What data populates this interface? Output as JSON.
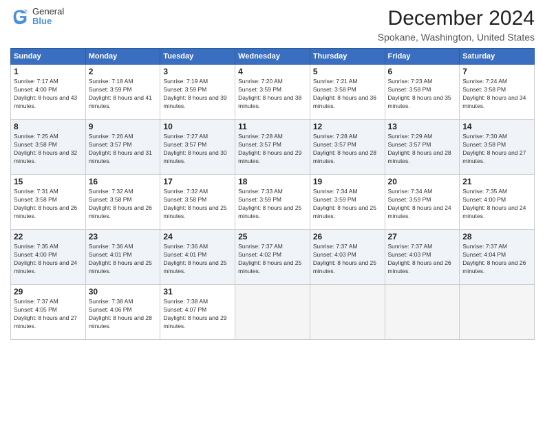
{
  "logo": {
    "general": "General",
    "blue": "Blue"
  },
  "header": {
    "title": "December 2024",
    "subtitle": "Spokane, Washington, United States"
  },
  "weekdays": [
    "Sunday",
    "Monday",
    "Tuesday",
    "Wednesday",
    "Thursday",
    "Friday",
    "Saturday"
  ],
  "weeks": [
    [
      {
        "day": "1",
        "sunrise": "7:17 AM",
        "sunset": "4:00 PM",
        "daylight": "8 hours and 43 minutes."
      },
      {
        "day": "2",
        "sunrise": "7:18 AM",
        "sunset": "3:59 PM",
        "daylight": "8 hours and 41 minutes."
      },
      {
        "day": "3",
        "sunrise": "7:19 AM",
        "sunset": "3:59 PM",
        "daylight": "8 hours and 39 minutes."
      },
      {
        "day": "4",
        "sunrise": "7:20 AM",
        "sunset": "3:59 PM",
        "daylight": "8 hours and 38 minutes."
      },
      {
        "day": "5",
        "sunrise": "7:21 AM",
        "sunset": "3:58 PM",
        "daylight": "8 hours and 36 minutes."
      },
      {
        "day": "6",
        "sunrise": "7:23 AM",
        "sunset": "3:58 PM",
        "daylight": "8 hours and 35 minutes."
      },
      {
        "day": "7",
        "sunrise": "7:24 AM",
        "sunset": "3:58 PM",
        "daylight": "8 hours and 34 minutes."
      }
    ],
    [
      {
        "day": "8",
        "sunrise": "7:25 AM",
        "sunset": "3:58 PM",
        "daylight": "8 hours and 32 minutes."
      },
      {
        "day": "9",
        "sunrise": "7:26 AM",
        "sunset": "3:57 PM",
        "daylight": "8 hours and 31 minutes."
      },
      {
        "day": "10",
        "sunrise": "7:27 AM",
        "sunset": "3:57 PM",
        "daylight": "8 hours and 30 minutes."
      },
      {
        "day": "11",
        "sunrise": "7:28 AM",
        "sunset": "3:57 PM",
        "daylight": "8 hours and 29 minutes."
      },
      {
        "day": "12",
        "sunrise": "7:28 AM",
        "sunset": "3:57 PM",
        "daylight": "8 hours and 28 minutes."
      },
      {
        "day": "13",
        "sunrise": "7:29 AM",
        "sunset": "3:57 PM",
        "daylight": "8 hours and 28 minutes."
      },
      {
        "day": "14",
        "sunrise": "7:30 AM",
        "sunset": "3:58 PM",
        "daylight": "8 hours and 27 minutes."
      }
    ],
    [
      {
        "day": "15",
        "sunrise": "7:31 AM",
        "sunset": "3:58 PM",
        "daylight": "8 hours and 26 minutes."
      },
      {
        "day": "16",
        "sunrise": "7:32 AM",
        "sunset": "3:58 PM",
        "daylight": "8 hours and 26 minutes."
      },
      {
        "day": "17",
        "sunrise": "7:32 AM",
        "sunset": "3:58 PM",
        "daylight": "8 hours and 25 minutes."
      },
      {
        "day": "18",
        "sunrise": "7:33 AM",
        "sunset": "3:59 PM",
        "daylight": "8 hours and 25 minutes."
      },
      {
        "day": "19",
        "sunrise": "7:34 AM",
        "sunset": "3:59 PM",
        "daylight": "8 hours and 25 minutes."
      },
      {
        "day": "20",
        "sunrise": "7:34 AM",
        "sunset": "3:59 PM",
        "daylight": "8 hours and 24 minutes."
      },
      {
        "day": "21",
        "sunrise": "7:35 AM",
        "sunset": "4:00 PM",
        "daylight": "8 hours and 24 minutes."
      }
    ],
    [
      {
        "day": "22",
        "sunrise": "7:35 AM",
        "sunset": "4:00 PM",
        "daylight": "8 hours and 24 minutes."
      },
      {
        "day": "23",
        "sunrise": "7:36 AM",
        "sunset": "4:01 PM",
        "daylight": "8 hours and 25 minutes."
      },
      {
        "day": "24",
        "sunrise": "7:36 AM",
        "sunset": "4:01 PM",
        "daylight": "8 hours and 25 minutes."
      },
      {
        "day": "25",
        "sunrise": "7:37 AM",
        "sunset": "4:02 PM",
        "daylight": "8 hours and 25 minutes."
      },
      {
        "day": "26",
        "sunrise": "7:37 AM",
        "sunset": "4:03 PM",
        "daylight": "8 hours and 25 minutes."
      },
      {
        "day": "27",
        "sunrise": "7:37 AM",
        "sunset": "4:03 PM",
        "daylight": "8 hours and 26 minutes."
      },
      {
        "day": "28",
        "sunrise": "7:37 AM",
        "sunset": "4:04 PM",
        "daylight": "8 hours and 26 minutes."
      }
    ],
    [
      {
        "day": "29",
        "sunrise": "7:37 AM",
        "sunset": "4:05 PM",
        "daylight": "8 hours and 27 minutes."
      },
      {
        "day": "30",
        "sunrise": "7:38 AM",
        "sunset": "4:06 PM",
        "daylight": "8 hours and 28 minutes."
      },
      {
        "day": "31",
        "sunrise": "7:38 AM",
        "sunset": "4:07 PM",
        "daylight": "8 hours and 29 minutes."
      },
      null,
      null,
      null,
      null
    ]
  ]
}
